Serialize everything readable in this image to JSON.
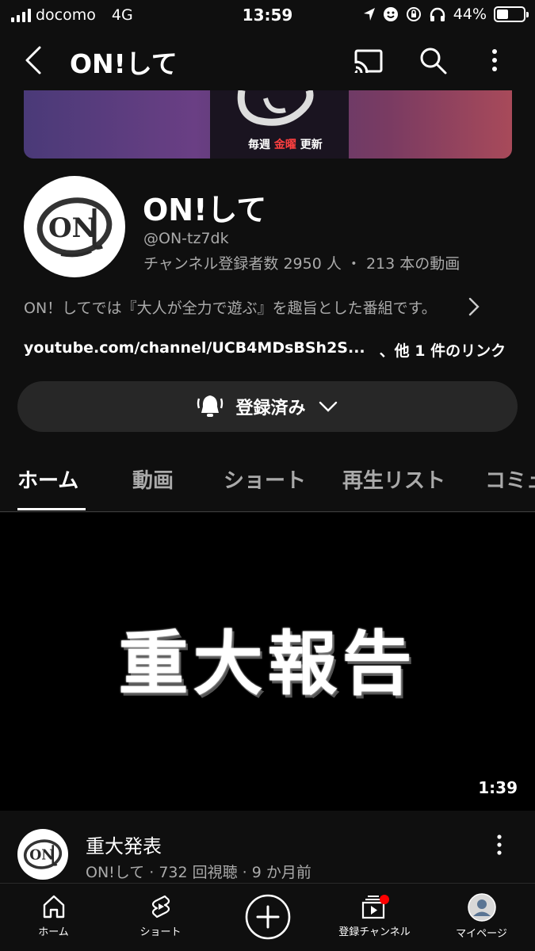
{
  "status_bar": {
    "carrier": "docomo",
    "network": "4G",
    "time": "13:59",
    "battery": "44%",
    "battery_level": 0.44
  },
  "app_bar": {
    "title": "ON!して",
    "icons": [
      "back-icon",
      "cast-icon",
      "search-icon",
      "more-vert-icon"
    ]
  },
  "banner": {
    "tag_before": "毎週",
    "tag_red": "金曜",
    "tag_after": "更新",
    "accent": "#ff4040"
  },
  "channel": {
    "name": "ON!して",
    "handle": "@ON-tz7dk",
    "stats": "チャンネル登録者数 2950 人 ・ 213 本の動画",
    "description": "ON！してでは『大人が全力で遊ぶ』を趣旨とした番組です。",
    "link": "youtube.com/channel/UCB4MDsBSh2S...",
    "other_links": "、他 1 件のリンク"
  },
  "subscribe": {
    "label": "登録済み"
  },
  "tabs": [
    "ホーム",
    "動画",
    "ショート",
    "再生リスト",
    "コミュ"
  ],
  "featured_video": {
    "headline": "重大報告",
    "duration": "1:39",
    "title": "重大発表",
    "meta": "ON!して · 732 回視聴 · 9 か月前"
  },
  "bottom_nav": {
    "items": [
      {
        "label": "ホーム",
        "icon": "home-icon"
      },
      {
        "label": "ショート",
        "icon": "shorts-icon"
      },
      {
        "label": "",
        "icon": "create-icon"
      },
      {
        "label": "登録チャンネル",
        "icon": "subscriptions-icon"
      },
      {
        "label": "マイページ",
        "icon": "avatar-icon"
      }
    ],
    "notification_color": "#ff0000"
  }
}
